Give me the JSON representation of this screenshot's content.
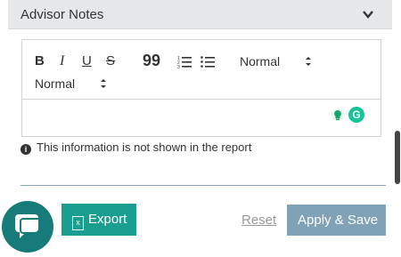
{
  "panel": {
    "title": "Advisor Notes"
  },
  "toolbar": {
    "bold": "B",
    "italic": "I",
    "underline": "U",
    "strike": "S",
    "quote": "99",
    "select_1": "Normal",
    "select_2": "Normal"
  },
  "info": {
    "text": "This information is not shown in the report"
  },
  "actions": {
    "export_label": "Export",
    "excel_glyph": "x",
    "reset_label": "Reset",
    "apply_label": "Apply & Save"
  },
  "colors": {
    "primary": "#1a9e8f",
    "apply_button": "#7fa2b6",
    "chat_bubble": "#177c79"
  }
}
